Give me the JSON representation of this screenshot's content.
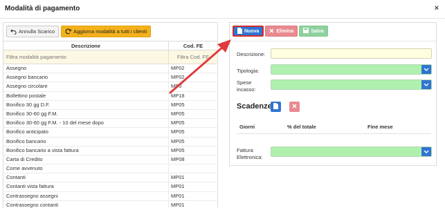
{
  "window": {
    "title": "Modalità di pagamento",
    "close_glyph": "×"
  },
  "left": {
    "toolbar": {
      "cancel_label": "Annulla Scarico",
      "update_label": "Aggiorna modalità a tutti i clienti"
    },
    "columns": {
      "description": "Descrizione",
      "code": "Cod. FE"
    },
    "filter": {
      "description_placeholder": "Filtra modalità pagamento",
      "code_placeholder": "Filtra Cod. FE"
    },
    "rows": [
      {
        "description": "Assegno",
        "code": "MP02"
      },
      {
        "description": "Assegno bancario",
        "code": "MP02"
      },
      {
        "description": "Assegno circolare",
        "code": "MP0"
      },
      {
        "description": "Bollettino postale",
        "code": "MP18"
      },
      {
        "description": "Bonifico 30 gg D.F.",
        "code": "MP05"
      },
      {
        "description": "Bonifico 30-60 gg F.M.",
        "code": "MP05"
      },
      {
        "description": "Bonifico 30-60 gg F.M. - 10 del mese dopo",
        "code": "MP05"
      },
      {
        "description": "Bonifico anticipato",
        "code": "MP05"
      },
      {
        "description": "Bonifico bancario",
        "code": "MP05"
      },
      {
        "description": "Bonifico bancario a vista fattura",
        "code": "MP05"
      },
      {
        "description": "Carta di Credito",
        "code": "MP08"
      },
      {
        "description": "Come avvenuto",
        "code": ""
      },
      {
        "description": "Contanti",
        "code": "MP01"
      },
      {
        "description": "Contanti vista fattura",
        "code": "MP01"
      },
      {
        "description": "Contrassegno assegni",
        "code": "MP01"
      },
      {
        "description": "Contrassegno contanti",
        "code": "MP01"
      }
    ]
  },
  "right": {
    "toolbar": {
      "new_label": "Nuova",
      "delete_label": "Elimina",
      "save_label": "Salva"
    },
    "form": {
      "description_label": "Descrizione:",
      "type_label": "Tipologia:",
      "fees_label_line1": "Spese",
      "fees_label_line2": "incasso:",
      "einvoice_label_line1": "Fattura",
      "einvoice_label_line2": "Elettronica:"
    },
    "deadlines": {
      "title": "Scadenze",
      "col_days": "Giorni",
      "col_percent": "% del totale",
      "col_end_month": "Fine mese"
    }
  },
  "colors": {
    "primary": "#2f74d0",
    "danger": "#e88a8f",
    "success": "#8fd19e",
    "warning": "#f3b21b",
    "annotation_arrow": "#e03c3c",
    "select_fill": "#aff0af",
    "input_fill": "#fefee0"
  },
  "icons": {
    "undo": "undo-icon",
    "refresh": "refresh-icon",
    "file": "file-icon",
    "times": "times-icon",
    "floppy": "floppy-icon",
    "chevron": "chevron-down-icon"
  }
}
